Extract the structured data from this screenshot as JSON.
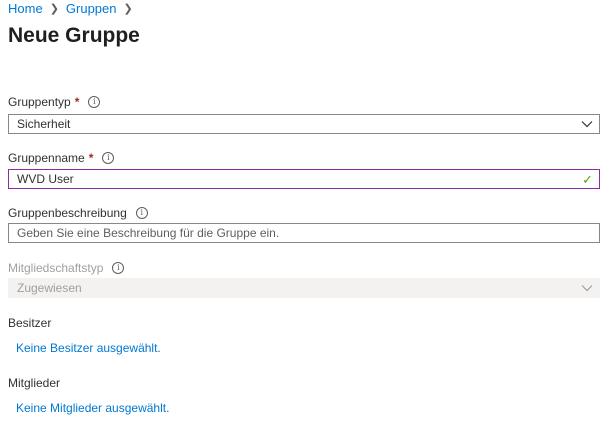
{
  "breadcrumb": {
    "home": "Home",
    "groups": "Gruppen"
  },
  "page": {
    "title": "Neue Gruppe"
  },
  "form": {
    "group_type": {
      "label": "Gruppentyp",
      "required": "*",
      "value": "Sicherheit"
    },
    "group_name": {
      "label": "Gruppenname",
      "required": "*",
      "value": "WVD User"
    },
    "group_description": {
      "label": "Gruppenbeschreibung",
      "placeholder": "Geben Sie eine Beschreibung für die Gruppe ein."
    },
    "membership_type": {
      "label": "Mitgliedschaftstyp",
      "value": "Zugewiesen"
    },
    "owners": {
      "label": "Besitzer",
      "link": "Keine Besitzer ausgewählt."
    },
    "members": {
      "label": "Mitglieder",
      "link": "Keine Mitglieder ausgewählt."
    }
  },
  "info_glyph": "i",
  "colors": {
    "accent": "#0078d4",
    "focus_border": "#8a2da5",
    "valid": "#57a300",
    "required": "#a4262c"
  }
}
